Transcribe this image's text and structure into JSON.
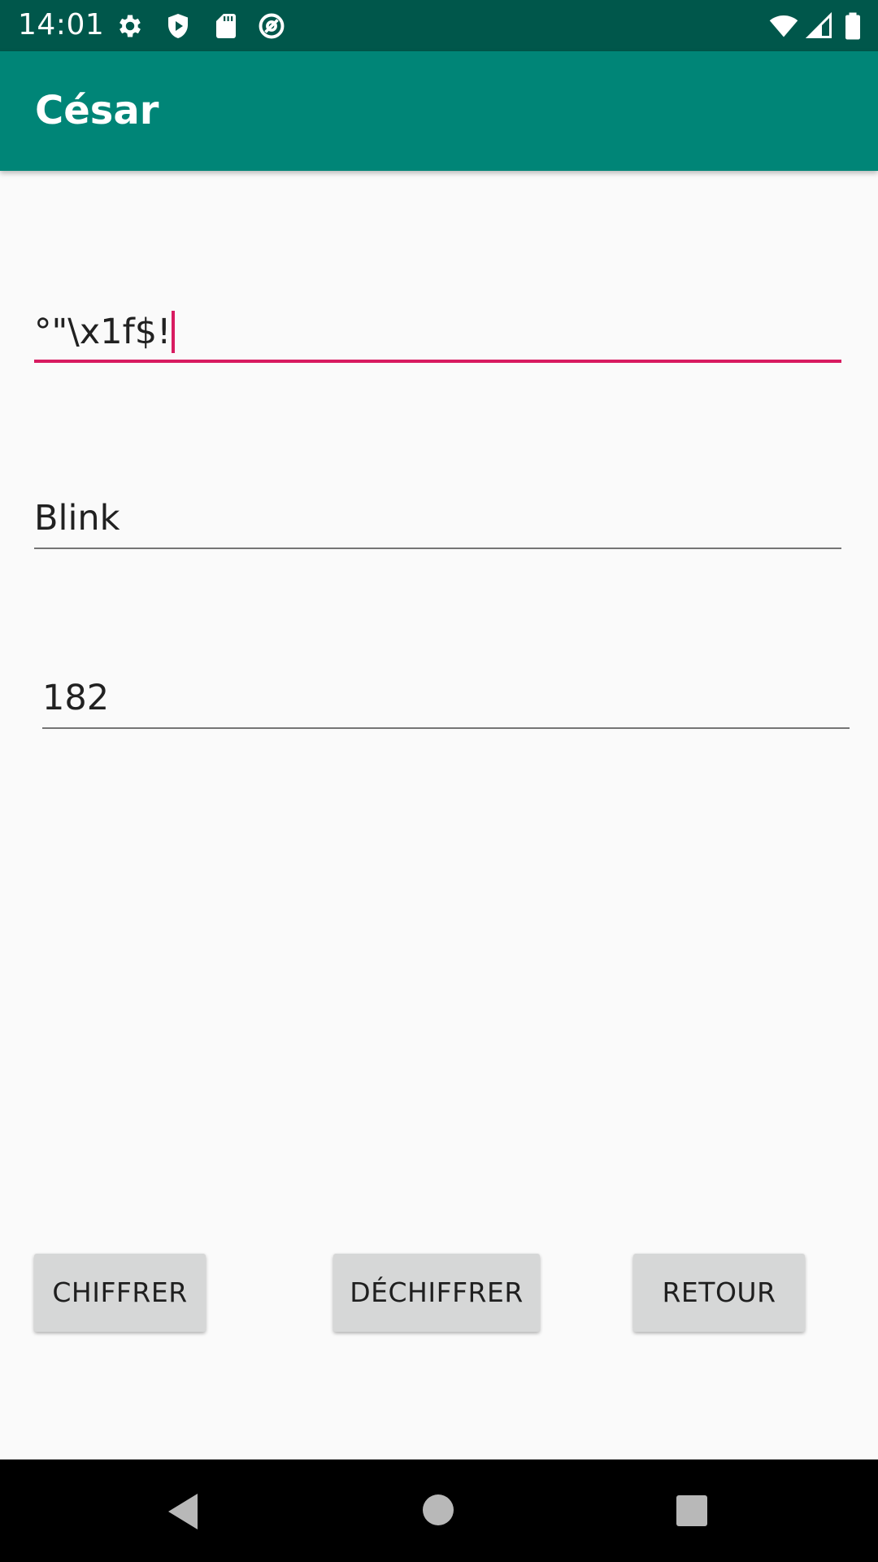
{
  "status_bar": {
    "time": "14:01",
    "icons_left": [
      "gear-icon",
      "shield-play-icon",
      "sd-card-icon",
      "at-sign-icon"
    ],
    "icons_right": [
      "wifi-icon",
      "cell-signal-icon",
      "battery-icon"
    ]
  },
  "app_bar": {
    "title": "César"
  },
  "form": {
    "message_value": "°\"\\x1f$!",
    "key_value": "Blink",
    "number_value": "182"
  },
  "buttons": {
    "encrypt_label": "CHIFFRER",
    "decrypt_label": "DÉCHIFFRER",
    "back_label": "RETOUR"
  },
  "nav_bar": {
    "icons": [
      "back-triangle-icon",
      "home-circle-icon",
      "recents-square-icon"
    ]
  },
  "colors": {
    "status_bar": "#00574b",
    "app_bar": "#008577",
    "accent": "#d81b60",
    "button": "#d6d7d7",
    "background": "#fafafa"
  }
}
